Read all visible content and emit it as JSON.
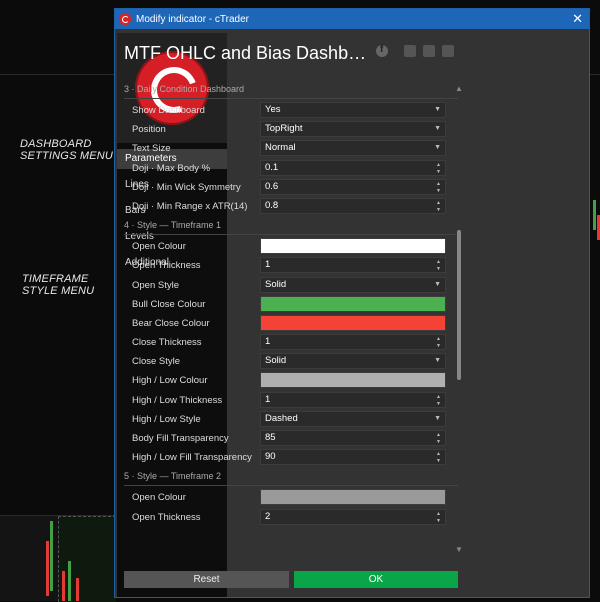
{
  "window": {
    "title": "Modify indicator - cTrader",
    "close_glyph": "✕"
  },
  "annotations": {
    "dashboard": [
      "DASHBOARD",
      "SETTINGS MENU"
    ],
    "timeframe": [
      "TIMEFRAME",
      "STYLE MENU"
    ]
  },
  "sidebar": {
    "items": [
      {
        "label": "Parameters",
        "active": true
      },
      {
        "label": "Lines",
        "active": false
      },
      {
        "label": "Bars",
        "active": false
      },
      {
        "label": "Levels",
        "active": false
      },
      {
        "label": "Additional",
        "active": false
      }
    ]
  },
  "header": {
    "title": "MTF OHLC and Bias Dashb…",
    "icons": [
      "facebook-icon",
      "image-icon",
      "save-icon",
      "trash-icon"
    ]
  },
  "sections": [
    {
      "title": "3 · Daily Condition Dashboard",
      "rows": [
        {
          "label": "Show Dashboard",
          "type": "select",
          "value": "Yes"
        },
        {
          "label": "Position",
          "type": "select",
          "value": "TopRight"
        },
        {
          "label": "Text Size",
          "type": "select",
          "value": "Normal"
        },
        {
          "label": "Doji · Max Body %",
          "type": "number",
          "value": "0.1"
        },
        {
          "label": "Doji · Min Wick Symmetry",
          "type": "number",
          "value": "0.6"
        },
        {
          "label": "Doji · Min Range x ATR(14)",
          "type": "number",
          "value": "0.8"
        }
      ]
    },
    {
      "title": "4 · Style — Timeframe 1",
      "rows": [
        {
          "label": "Open Colour",
          "type": "color",
          "value": "#ffffff"
        },
        {
          "label": "Open Thickness",
          "type": "number",
          "value": "1"
        },
        {
          "label": "Open Style",
          "type": "select",
          "value": "Solid"
        },
        {
          "label": "Bull Close Colour",
          "type": "color",
          "value": "#4caf50"
        },
        {
          "label": "Bear Close Colour",
          "type": "color",
          "value": "#f44336"
        },
        {
          "label": "Close Thickness",
          "type": "number",
          "value": "1"
        },
        {
          "label": "Close Style",
          "type": "select",
          "value": "Solid"
        },
        {
          "label": "High / Low Colour",
          "type": "color",
          "value": "#b0b0b0"
        },
        {
          "label": "High / Low Thickness",
          "type": "number",
          "value": "1"
        },
        {
          "label": "High / Low Style",
          "type": "select",
          "value": "Dashed"
        },
        {
          "label": "Body Fill Transparency",
          "type": "number",
          "value": "85"
        },
        {
          "label": "High / Low Fill Transparency",
          "type": "number",
          "value": "90"
        }
      ]
    },
    {
      "title": "5 · Style — Timeframe 2",
      "rows": [
        {
          "label": "Open Colour",
          "type": "color",
          "value": "#9a9a9a"
        },
        {
          "label": "Open Thickness",
          "type": "number",
          "value": "2"
        }
      ]
    }
  ],
  "footer": {
    "reset_label": "Reset",
    "ok_label": "OK"
  },
  "colors": {
    "accent": "#1e66b8",
    "ok": "#0aa548",
    "brand": "#d51e25"
  }
}
